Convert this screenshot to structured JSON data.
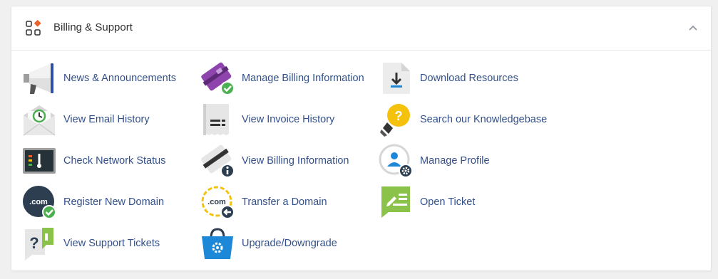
{
  "panel": {
    "title": "Billing & Support",
    "icon": "grid-apps-icon",
    "collapse_icon": "chevron-up-icon"
  },
  "items": [
    {
      "label": "News & Announcements",
      "icon": "megaphone-icon"
    },
    {
      "label": "Manage Billing Information",
      "icon": "credit-card-check-icon"
    },
    {
      "label": "Download Resources",
      "icon": "download-file-icon"
    },
    {
      "label": "View Email History",
      "icon": "email-clock-icon"
    },
    {
      "label": "View Invoice History",
      "icon": "invoice-icon"
    },
    {
      "label": "Search our Knowledgebase",
      "icon": "lightbulb-question-icon"
    },
    {
      "label": "Check Network Status",
      "icon": "network-status-monitor-icon"
    },
    {
      "label": "View Billing Information",
      "icon": "card-info-icon"
    },
    {
      "label": "Manage Profile",
      "icon": "profile-gear-icon"
    },
    {
      "label": "Register New Domain",
      "icon": "domain-register-icon"
    },
    {
      "label": "Transfer a Domain",
      "icon": "domain-transfer-icon"
    },
    {
      "label": "Open Ticket",
      "icon": "ticket-edit-icon"
    },
    {
      "label": "View Support Tickets",
      "icon": "support-tickets-icon"
    },
    {
      "label": "Upgrade/Downgrade",
      "icon": "shopping-bag-gear-icon"
    }
  ],
  "colors": {
    "link": "#33508a",
    "title": "#333333",
    "accent_orange": "#e8632b",
    "check_green": "#4caf50",
    "purple": "#8e44ad",
    "yellow": "#f4c20d",
    "green_ticket": "#8bc34a",
    "blue_bag": "#1e88d8",
    "dark": "#2c3e50"
  }
}
